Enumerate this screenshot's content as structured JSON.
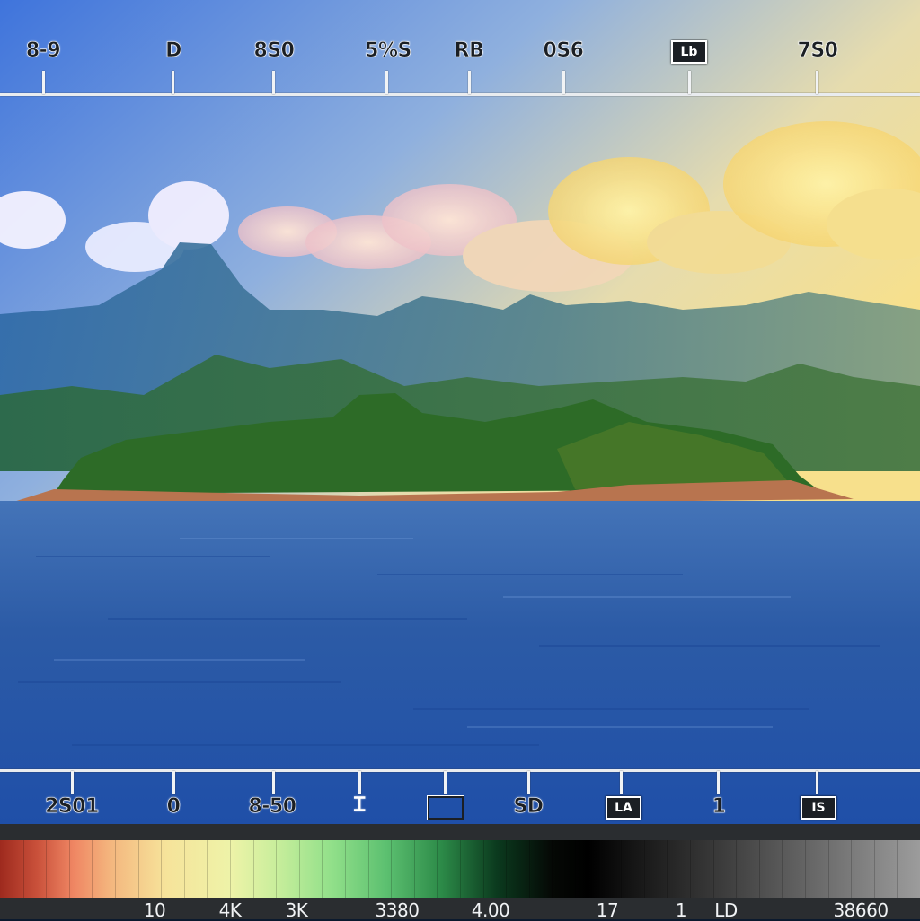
{
  "top_ruler": {
    "labels": [
      "8-9",
      "D",
      "8S0",
      "5%S",
      "RB",
      "0S6",
      "7S0"
    ],
    "icon_label": "Lb"
  },
  "bottom_ruler": {
    "labels": [
      "2S01",
      "0",
      "8-50",
      "SD",
      "1"
    ],
    "icons": [
      "⌶",
      "",
      "LA",
      "IS"
    ]
  },
  "gradient_bar": {
    "labels": [
      "10",
      "4K",
      "3K",
      "3380",
      "4.00",
      "17",
      "1",
      "LD",
      "38660"
    ]
  },
  "colors": {
    "sky_top": "#4a7fe0",
    "sky_warm": "#f6d98a",
    "water": "#2a5db0",
    "island_green": "#2f6b2a"
  }
}
